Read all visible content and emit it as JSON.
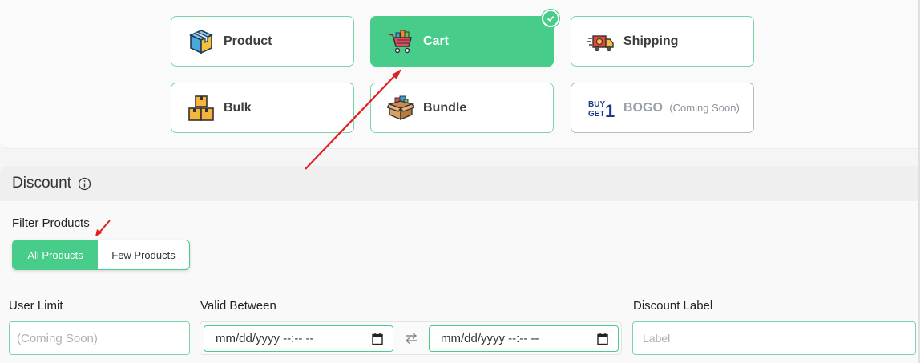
{
  "discount_types": [
    {
      "id": "product",
      "label": "Product",
      "icon": "product-box-icon"
    },
    {
      "id": "cart",
      "label": "Cart",
      "icon": "shopping-cart-icon",
      "active": true
    },
    {
      "id": "shipping",
      "label": "Shipping",
      "icon": "delivery-truck-icon"
    },
    {
      "id": "bulk",
      "label": "Bulk",
      "icon": "stacked-boxes-icon"
    },
    {
      "id": "bundle",
      "label": "Bundle",
      "icon": "open-box-icon"
    },
    {
      "id": "bogo",
      "label": "BOGO",
      "suffix": "(Coming Soon)",
      "icon": "buy-get-1-icon",
      "icon_text": "BUY GET 1",
      "disabled": true
    }
  ],
  "discount": {
    "title": "Discount",
    "filter_label": "Filter Products",
    "filter_options": [
      "All Products",
      "Few Products"
    ],
    "filter_selected": "All Products",
    "user_limit": {
      "label": "User Limit",
      "placeholder": "(Coming Soon)"
    },
    "valid_between": {
      "label": "Valid Between",
      "start_placeholder": "mm/dd/yyyy --:-- --",
      "end_placeholder": "mm/dd/yyyy --:-- --"
    },
    "discount_label": {
      "label": "Discount Label",
      "placeholder": "Label"
    }
  },
  "colors": {
    "accent": "#48cc89",
    "accent_border": "#7dd3a8",
    "annotation_arrow": "#e02020"
  }
}
